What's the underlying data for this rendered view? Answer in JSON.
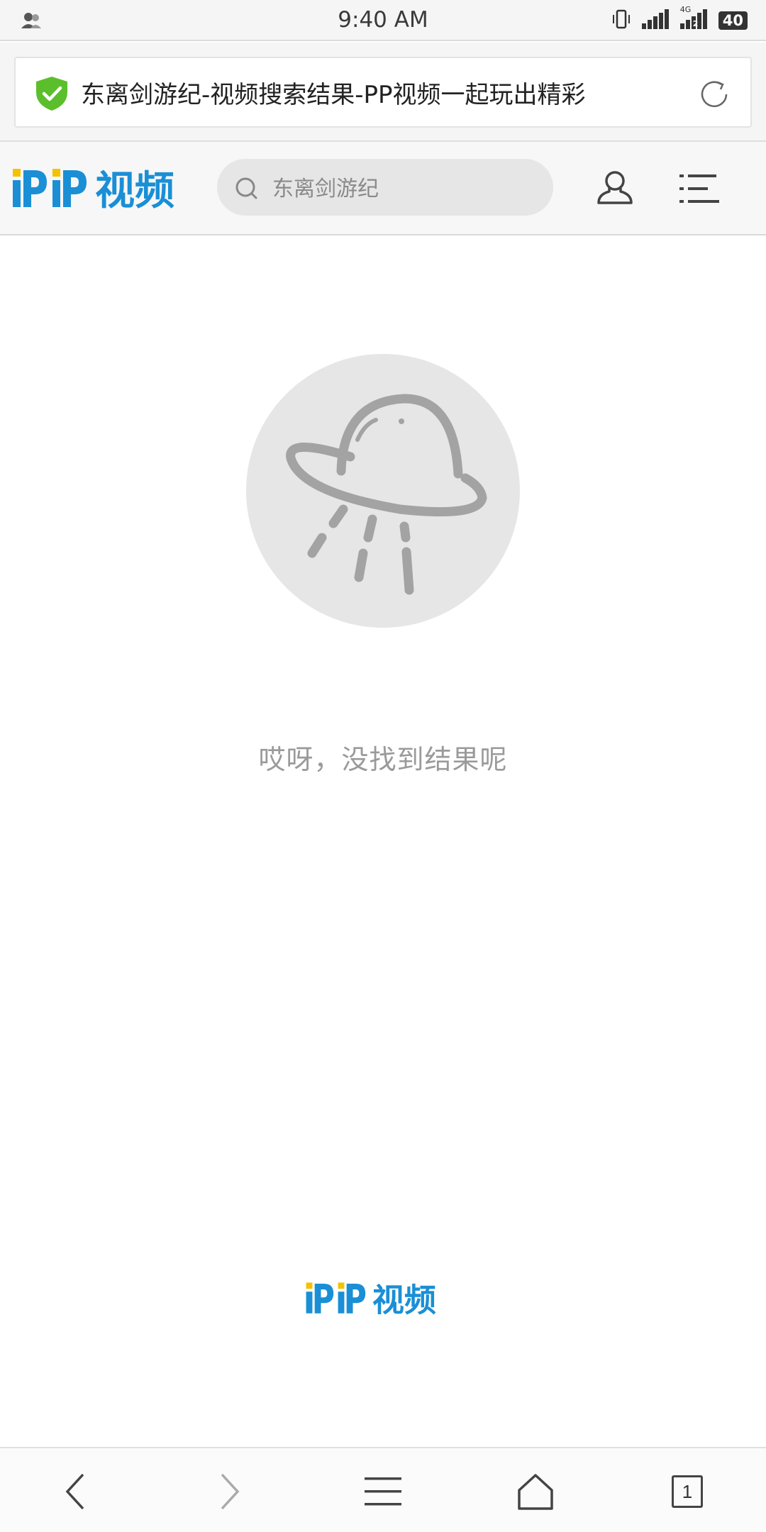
{
  "status_bar": {
    "time": "9:40 AM",
    "network": "4G",
    "sim": "2",
    "battery": "40"
  },
  "address_bar": {
    "page_title": "东离剑游纪-视频搜索结果-PP视频一起玩出精彩",
    "secure_color": "#5bbf2b"
  },
  "header": {
    "logo_text": "视频",
    "search_text": "东离剑游纪",
    "brand_blue": "#1a8fd6",
    "brand_yellow": "#f5c200"
  },
  "empty_state": {
    "message": "哎呀，没找到结果呢",
    "icon": "ufo-icon"
  },
  "footer": {
    "logo_text": "视频"
  },
  "toolbar": {
    "tabs_count": "1"
  }
}
